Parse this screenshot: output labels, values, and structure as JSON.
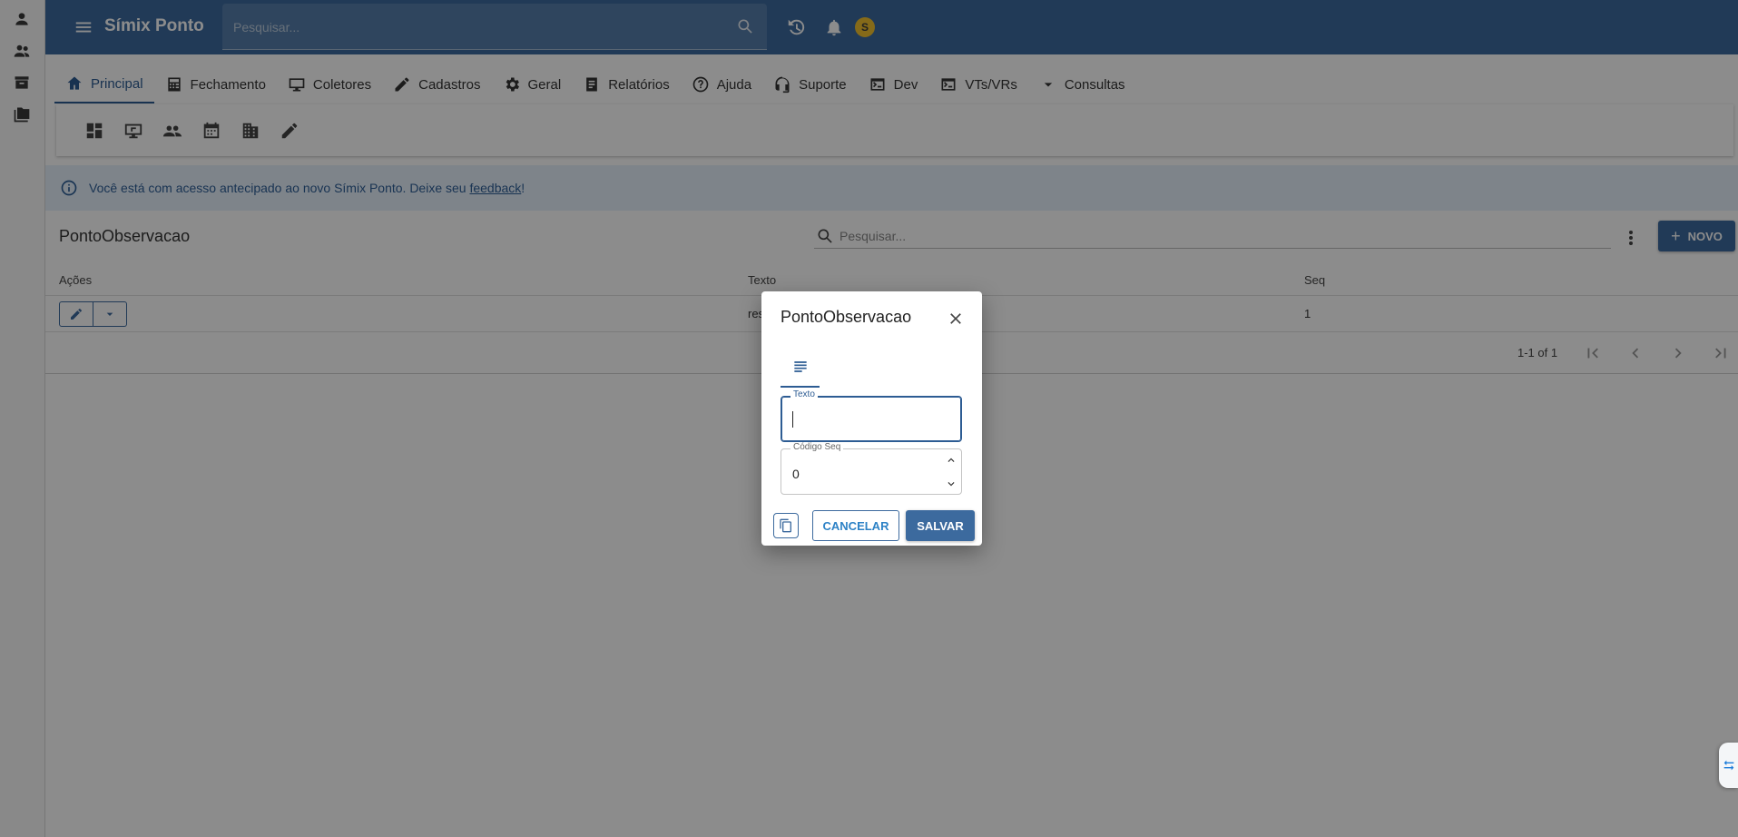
{
  "topbar": {
    "app_title": "Símix Ponto",
    "search_placeholder": "Pesquisar...",
    "avatar_initial": "S"
  },
  "nav": {
    "tabs": [
      {
        "label": "Principal",
        "icon": "home-icon",
        "active": true
      },
      {
        "label": "Fechamento",
        "icon": "calculator-icon"
      },
      {
        "label": "Coletores",
        "icon": "monitor-icon"
      },
      {
        "label": "Cadastros",
        "icon": "pencil-icon"
      },
      {
        "label": "Geral",
        "icon": "gear-icon"
      },
      {
        "label": "Relatórios",
        "icon": "document-icon"
      },
      {
        "label": "Ajuda",
        "icon": "help-icon"
      },
      {
        "label": "Suporte",
        "icon": "support-icon"
      },
      {
        "label": "Dev",
        "icon": "terminal-icon"
      },
      {
        "label": "VTs/VRs",
        "icon": "terminal-icon"
      },
      {
        "label": "Consultas",
        "icon": "caret-down-icon"
      }
    ]
  },
  "banner": {
    "text_before": "Você está com acesso antecipado ao novo Símix Ponto. Deixe seu ",
    "link": "feedback",
    "text_after": "!"
  },
  "list": {
    "title": "PontoObservacao",
    "search_placeholder": "Pesquisar...",
    "new_button": "NOVO",
    "columns": {
      "acoes": "Ações",
      "texto": "Texto",
      "seq": "Seq"
    },
    "rows": [
      {
        "texto": "res",
        "seq": "1"
      }
    ],
    "pagination": "1-1 of 1"
  },
  "dialog": {
    "title": "PontoObservacao",
    "texto_label": "Texto",
    "texto_value": "",
    "seq_label": "Código Seq",
    "seq_value": "0",
    "cancel_label": "CANCELAR",
    "save_label": "SALVAR"
  },
  "colors": {
    "primary": "#3c6a9e",
    "banner_bg": "#e6f0fb",
    "avatar": "#f2c12e"
  }
}
